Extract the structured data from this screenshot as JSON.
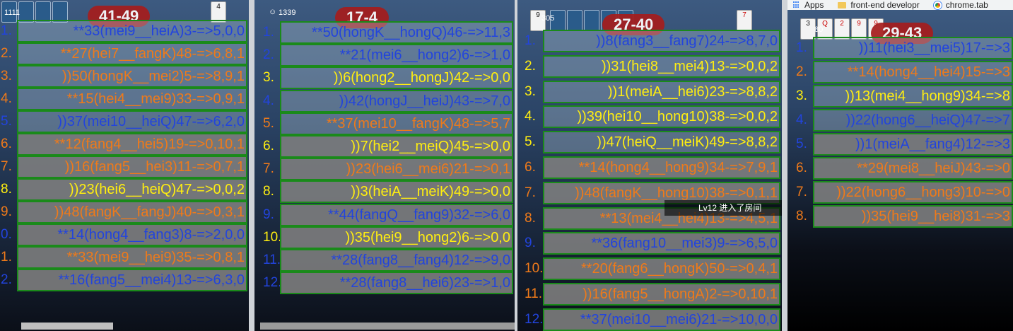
{
  "bookmarks": [
    {
      "label": "Apps",
      "icon": "apps-grid-icon"
    },
    {
      "label": "front-end developr",
      "icon": "folder-icon"
    },
    {
      "label": "chrome.tab",
      "icon": "chrome-icon"
    }
  ],
  "notification": {
    "text": "Lv12 进入了房间"
  },
  "panels": [
    {
      "score": "41-49",
      "player_id": "1111",
      "cards": [
        "",
        "",
        "",
        "",
        "4"
      ],
      "rows": [
        {
          "n": "1.",
          "text": "**33(mei9__heiA)3-=>5,0,0",
          "color": "blue",
          "clear": true
        },
        {
          "n": "2.",
          "text": "**27(hei7__fangK)48-=>6,8,1",
          "color": "orange",
          "clear": true
        },
        {
          "n": "3.",
          "text": "))50(hongK__mei2)5-=>8,9,1",
          "color": "orange",
          "clear": true
        },
        {
          "n": "4.",
          "text": "**15(hei4__mei9)33-=>0,9,1",
          "color": "orange",
          "clear": true
        },
        {
          "n": "5.",
          "text": "))37(mei10__heiQ)47-=>6,2,0",
          "color": "blue",
          "clear": true
        },
        {
          "n": "6.",
          "text": "**12(fang4__hei5)19-=>0,10,1",
          "color": "orange",
          "clear": false
        },
        {
          "n": "7.",
          "text": "))16(fang5__hei3)11-=>0,7,1",
          "color": "orange",
          "clear": false
        },
        {
          "n": "8.",
          "text": "))23(hei6__heiQ)47-=>0,0,2",
          "color": "yellow",
          "clear": false
        },
        {
          "n": "9.",
          "text": "))48(fangK__fangJ)40-=>0,3,1",
          "color": "orange",
          "clear": false
        },
        {
          "n": "0.",
          "text": "**14(hong4__fang3)8-=>2,0,0",
          "color": "blue",
          "clear": false
        },
        {
          "n": "1.",
          "text": "**33(mei9__hei9)35-=>0,8,1",
          "color": "orange",
          "clear": false
        },
        {
          "n": "2.",
          "text": "**16(fang5__mei4)13-=>6,3,0",
          "color": "blue",
          "clear": false
        }
      ]
    },
    {
      "score": "17-4",
      "player_id": "1339",
      "cards": [],
      "rows": [
        {
          "n": "1.",
          "text": "**50(hongK__hongQ)46-=>11,3",
          "color": "blue",
          "clear": true
        },
        {
          "n": "2.",
          "text": "**21(mei6__hong2)6-=>1,0",
          "color": "blue",
          "clear": true
        },
        {
          "n": "3.",
          "text": "))6(hong2__hongJ)42-=>0,0",
          "color": "yellow",
          "clear": true
        },
        {
          "n": "4.",
          "text": "))42(hongJ__heiJ)43-=>7,0",
          "color": "blue",
          "clear": true
        },
        {
          "n": "5.",
          "text": "**37(mei10__fangK)48-=>5,7",
          "color": "orange",
          "clear": true
        },
        {
          "n": "6.",
          "text": "))7(hei2__meiQ)45-=>0,0",
          "color": "yellow",
          "clear": false
        },
        {
          "n": "7.",
          "text": "))23(hei6__mei6)21-=>0,1",
          "color": "orange",
          "clear": false
        },
        {
          "n": "8.",
          "text": "))3(heiA__meiK)49-=>0,0",
          "color": "yellow",
          "clear": false
        },
        {
          "n": "9.",
          "text": "**44(fangQ__fang9)32-=>6,0",
          "color": "blue",
          "clear": false
        },
        {
          "n": "10.",
          "text": "))35(hei9__hong2)6-=>0,0",
          "color": "yellow",
          "clear": false
        },
        {
          "n": "11.",
          "text": "**28(fang8__fang4)12-=>9,0",
          "color": "blue",
          "clear": false
        },
        {
          "n": "12.",
          "text": "**28(fang8__hei6)23-=>1,0",
          "color": "blue",
          "clear": false
        }
      ]
    },
    {
      "score": "27-40",
      "player_id": "305",
      "cards": [
        "9",
        "",
        "",
        "",
        "",
        "",
        "7"
      ],
      "rows": [
        {
          "n": "1.",
          "text": "))8(fang3__fang7)24-=>8,7,0",
          "color": "blue",
          "clear": true
        },
        {
          "n": "2.",
          "text": "))31(hei8__mei4)13-=>0,0,2",
          "color": "yellow",
          "clear": true
        },
        {
          "n": "3.",
          "text": "))1(meiA__hei6)23-=>8,8,2",
          "color": "yellow",
          "clear": true
        },
        {
          "n": "4.",
          "text": "))39(hei10__hong10)38-=>0,0,2",
          "color": "yellow",
          "clear": true
        },
        {
          "n": "5.",
          "text": "))47(heiQ__meiK)49-=>8,8,2",
          "color": "yellow",
          "clear": true
        },
        {
          "n": "6.",
          "text": "**14(hong4__hong9)34-=>7,9,1",
          "color": "orange",
          "clear": false
        },
        {
          "n": "7.",
          "text": "))48(fangK__hong10)38-=>0,1,1",
          "color": "orange",
          "clear": false
        },
        {
          "n": "8.",
          "text": "**13(mei4__hei4)13-=>4,5,1",
          "color": "orange",
          "clear": false
        },
        {
          "n": "9.",
          "text": "**36(fang10__mei3)9-=>6,5,0",
          "color": "blue",
          "clear": false
        },
        {
          "n": "10.",
          "text": "**20(fang6__hongK)50-=>0,4,1",
          "color": "orange",
          "clear": false
        },
        {
          "n": "11.",
          "text": "))16(fang5__hongA)2-=>0,10,1",
          "color": "orange",
          "clear": false
        },
        {
          "n": "12.",
          "text": "**37(mei10__mei6)21-=>10,0,0",
          "color": "blue",
          "clear": false
        }
      ]
    },
    {
      "score": "29-43",
      "player_id": "80",
      "cards": [
        "3",
        "Q",
        "2",
        "9",
        "9"
      ],
      "rows": [
        {
          "n": "1.",
          "text": "))11(hei3__mei5)17-=>3",
          "color": "blue",
          "clear": true
        },
        {
          "n": "2.",
          "text": "**14(hong4__hei4)15-=>3",
          "color": "orange",
          "clear": true
        },
        {
          "n": "3.",
          "text": "))13(mei4__hong9)34-=>8",
          "color": "yellow",
          "clear": true
        },
        {
          "n": "4.",
          "text": "))22(hong6__heiQ)47-=>7",
          "color": "blue",
          "clear": true
        },
        {
          "n": "5.",
          "text": "))1(meiA__fang4)12-=>3",
          "color": "blue",
          "clear": false
        },
        {
          "n": "6.",
          "text": "**29(mei8__heiJ)43-=>0",
          "color": "orange",
          "clear": false
        },
        {
          "n": "7.",
          "text": "))22(hong6__hong3)10-=>0",
          "color": "orange",
          "clear": false
        },
        {
          "n": "8.",
          "text": "))35(hei9__hei8)31-=>3",
          "color": "orange",
          "clear": false
        }
      ]
    }
  ]
}
